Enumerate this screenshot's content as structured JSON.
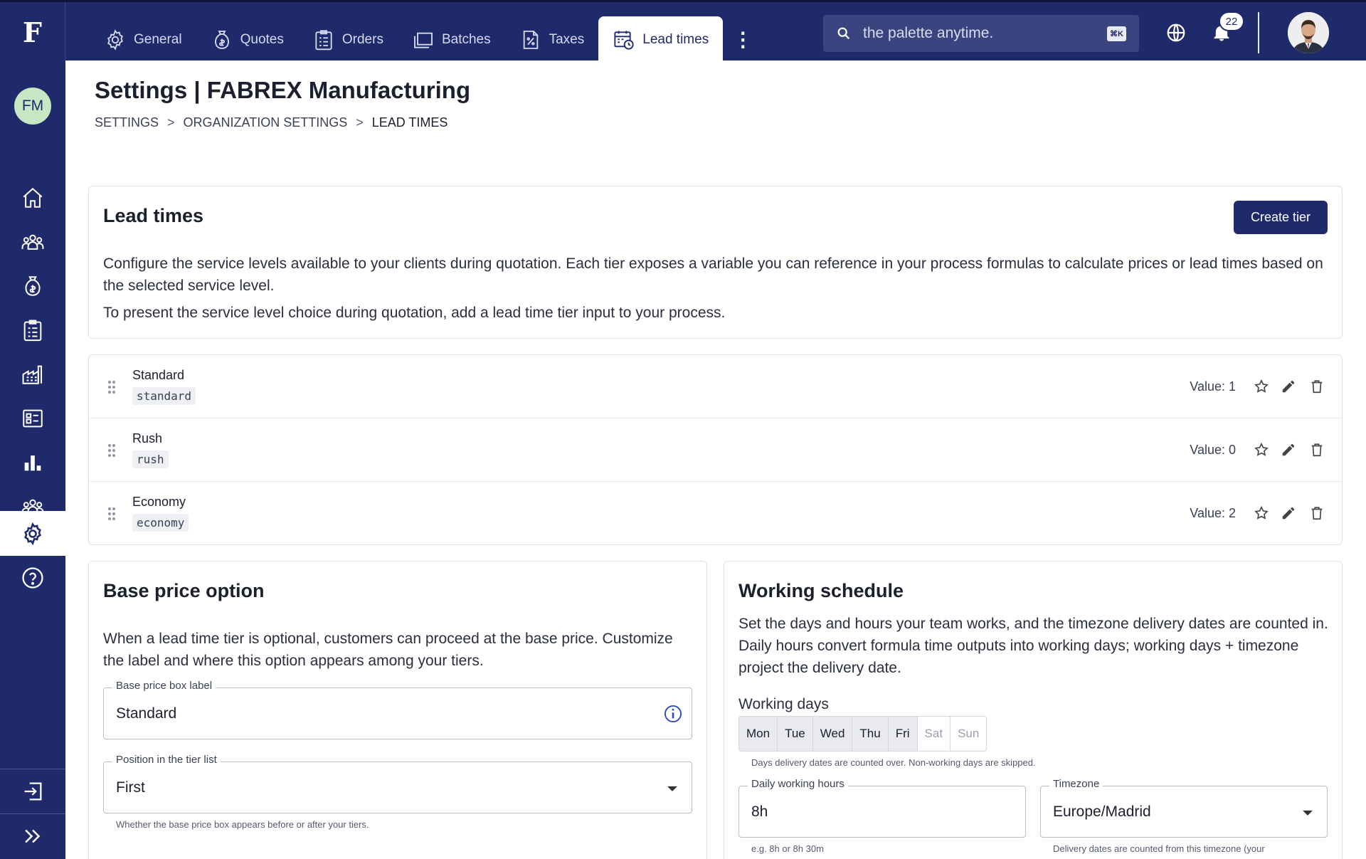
{
  "app": {
    "logo": "F"
  },
  "nav_tabs": [
    {
      "label": "General",
      "icon": "gear-icon"
    },
    {
      "label": "Quotes",
      "icon": "money-bag-icon"
    },
    {
      "label": "Orders",
      "icon": "clipboard-icon"
    },
    {
      "label": "Batches",
      "icon": "stack-icon"
    },
    {
      "label": "Taxes",
      "icon": "tax-document-icon"
    },
    {
      "label": "Lead times",
      "icon": "calendar-clock-icon",
      "active": true
    }
  ],
  "search": {
    "placeholder": "the palette anytime.",
    "shortcut": "⌘K"
  },
  "notifications": {
    "count": "22"
  },
  "sidebar": {
    "org_initials": "FM",
    "items": [
      "home-icon",
      "customers-icon",
      "quotes-icon",
      "orders-icon",
      "factory-icon",
      "catalog-icon",
      "analytics-icon",
      "team-icon",
      "settings-icon",
      "help-icon"
    ],
    "active_item": "settings-icon",
    "bottom": [
      "logout-icon",
      "expand-icon"
    ]
  },
  "page": {
    "title": "Settings | FABREX Manufacturing",
    "breadcrumb": [
      "SETTINGS",
      "ORGANIZATION SETTINGS",
      "LEAD TIMES"
    ],
    "breadcrumb_separator": ">"
  },
  "lead_times": {
    "title": "Lead times",
    "create_button": "Create tier",
    "description_1": "Configure the service levels available to your clients during quotation. Each tier exposes a variable you can reference in your process formulas to calculate prices or lead times based on the selected service level.",
    "description_2": "To present the service level choice during quotation, add a lead time tier input to your process.",
    "tiers": [
      {
        "name": "Standard",
        "code": "standard",
        "value": "Value: 1"
      },
      {
        "name": "Rush",
        "code": "rush",
        "value": "Value: 0"
      },
      {
        "name": "Economy",
        "code": "economy",
        "value": "Value: 2"
      }
    ]
  },
  "base_price": {
    "title": "Base price option",
    "description": "When a lead time tier is optional, customers can proceed at the base price. Customize the label and where this option appears among your tiers.",
    "label_field": {
      "label": "Base price box label",
      "value": "Standard"
    },
    "position_field": {
      "label": "Position in the tier list",
      "value": "First"
    },
    "position_helper": "Whether the base price box appears before or after your tiers."
  },
  "working_schedule": {
    "title": "Working schedule",
    "description": "Set the days and hours your team works, and the timezone delivery dates are counted in. Daily hours convert formula time outputs into working days; working days + timezone project the delivery date.",
    "days_label": "Working days",
    "days": [
      {
        "label": "Mon",
        "on": true
      },
      {
        "label": "Tue",
        "on": true
      },
      {
        "label": "Wed",
        "on": true
      },
      {
        "label": "Thu",
        "on": true
      },
      {
        "label": "Fri",
        "on": true
      },
      {
        "label": "Sat",
        "on": false
      },
      {
        "label": "Sun",
        "on": false
      }
    ],
    "days_helper": "Days delivery dates are counted over. Non-working days are skipped.",
    "hours_field": {
      "label": "Daily working hours",
      "value": "8h"
    },
    "hours_helper": "e.g. 8h or 8h 30m",
    "timezone_field": {
      "label": "Timezone",
      "value": "Europe/Madrid"
    },
    "timezone_helper": "Delivery dates are counted from this timezone (your"
  },
  "colors": {
    "navy": "#1f2a6b",
    "org_avatar": "#c7e6c4",
    "info_blue": "#2a49c6"
  }
}
